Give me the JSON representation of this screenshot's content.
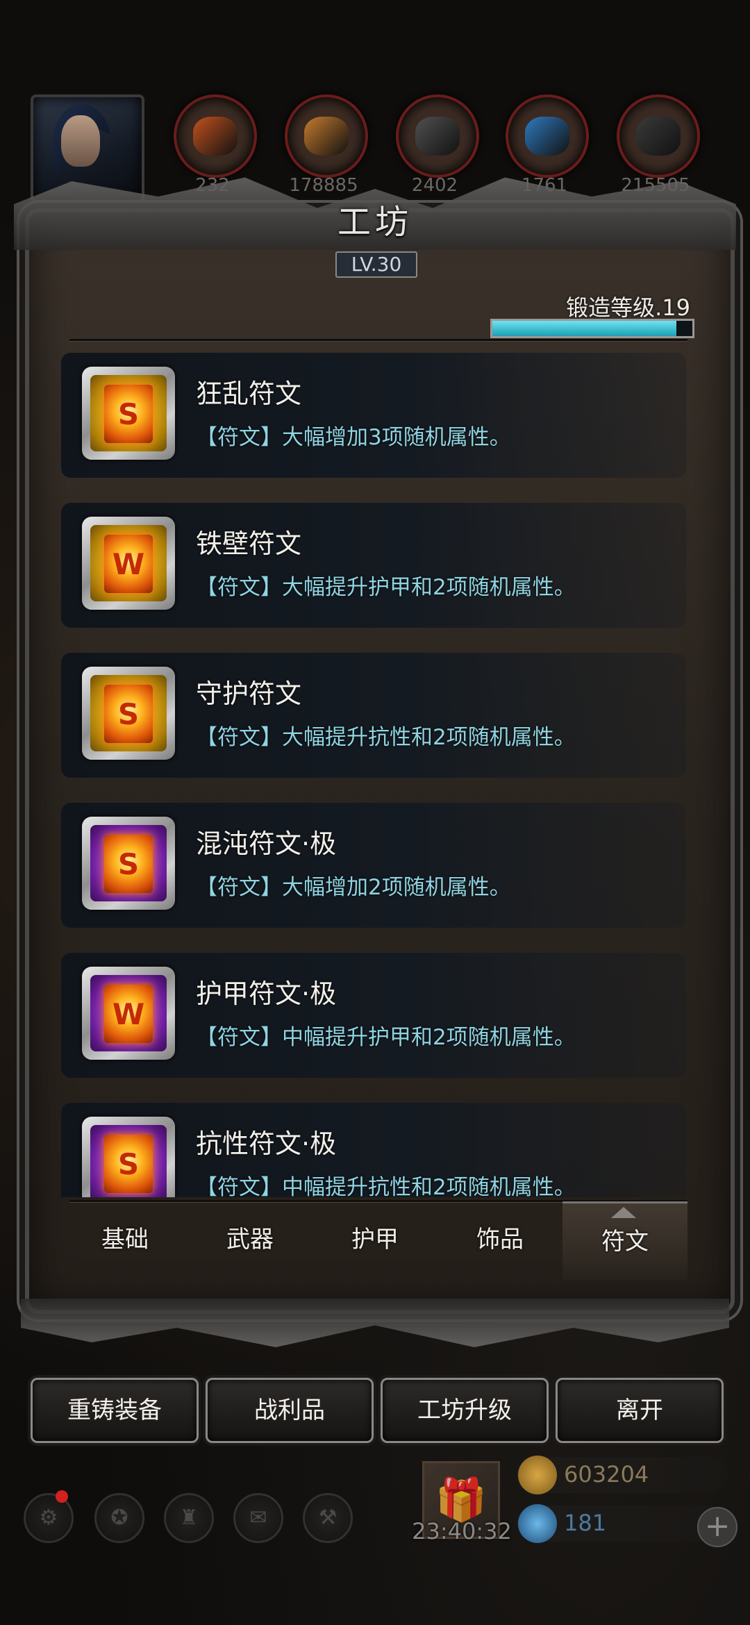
{
  "resources": [
    {
      "name": "copper-ore",
      "count": "232",
      "color": "#c2521e"
    },
    {
      "name": "wood-planks",
      "count": "178885",
      "color": "#c67b2e"
    },
    {
      "name": "iron-ingot",
      "count": "2402",
      "color": "#505050"
    },
    {
      "name": "blue-crystal",
      "count": "1761",
      "color": "#2f7ac0"
    },
    {
      "name": "dark-iron",
      "count": "215505",
      "color": "#3a3a3a"
    }
  ],
  "workshop": {
    "title": "工坊",
    "level": "LV.30",
    "forge_level_label": "锻造等级.19",
    "forge_progress": 0.92
  },
  "items": [
    {
      "name": "狂乱符文",
      "desc": "【符文】大幅增加3项随机属性。",
      "tier": "gold",
      "rune": "S"
    },
    {
      "name": "铁壁符文",
      "desc": "【符文】大幅提升护甲和2项随机属性。",
      "tier": "gold",
      "rune": "W"
    },
    {
      "name": "守护符文",
      "desc": "【符文】大幅提升抗性和2项随机属性。",
      "tier": "gold",
      "rune": "S"
    },
    {
      "name": "混沌符文·极",
      "desc": "【符文】大幅增加2项随机属性。",
      "tier": "purple",
      "rune": "S"
    },
    {
      "name": "护甲符文·极",
      "desc": "【符文】中幅提升护甲和2项随机属性。",
      "tier": "purple",
      "rune": "W"
    },
    {
      "name": "抗性符文·极",
      "desc": "【符文】中幅提升抗性和2项随机属性。",
      "tier": "purple",
      "rune": "S"
    }
  ],
  "tabs": [
    "基础",
    "武器",
    "护甲",
    "饰品",
    "符文"
  ],
  "active_tab": "符文",
  "actions": [
    "重铸装备",
    "战利品",
    "工坊升级",
    "离开"
  ],
  "timer": "23:40:32",
  "gold": "603204",
  "gems": "181"
}
